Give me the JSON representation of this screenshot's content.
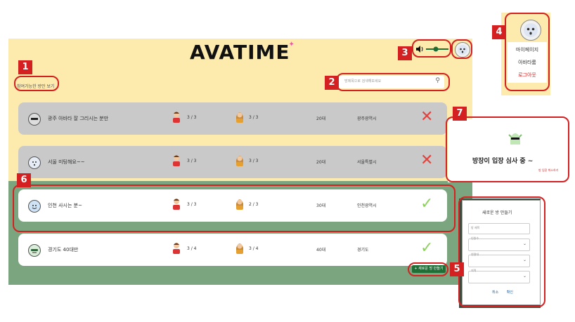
{
  "header": {
    "logo": "AVATIME",
    "filter_link": "참여가능한 방만 보기",
    "search_placeholder": "방제목으로 검색해보세요"
  },
  "rooms": [
    {
      "title": "광주 아바타 잘 그리시는 분만",
      "male": "3 / 3",
      "female": "3 / 3",
      "age": "20대",
      "region": "광주광역시",
      "status": "✕"
    },
    {
      "title": "서울 미팅해요~~",
      "male": "3 / 3",
      "female": "3 / 3",
      "age": "20대",
      "region": "서울특별시",
      "status": "✕"
    },
    {
      "title": "인천 사시는 분~",
      "male": "3 / 3",
      "female": "2 / 3",
      "age": "30대",
      "region": "인천광역시",
      "status": "✓"
    },
    {
      "title": "경기도 40대만",
      "male": "3 / 4",
      "female": "3 / 4",
      "age": "40대",
      "region": "경기도",
      "status": "✓"
    }
  ],
  "create_button": "+ 새로운 방 만들기",
  "dropdown": {
    "items": [
      "마이페이지",
      "아바타룸",
      "로그아웃"
    ]
  },
  "waiting": {
    "text": "방장이 입장 심사 중 ~",
    "exit": "방 입장 취소하기"
  },
  "form": {
    "title": "새로운 방 만들기",
    "fields": [
      "방 제목",
      "인원수",
      "연령대",
      "지역"
    ],
    "cancel": "취소",
    "confirm": "확인"
  },
  "callouts": [
    "1",
    "2",
    "3",
    "4",
    "5",
    "6",
    "7"
  ],
  "colors": {
    "bg_yellow": "#fdebae",
    "bg_green": "#7aa57f",
    "callout_red": "#d42020",
    "full_row": "#c9c9c9",
    "x_red": "#e0433e",
    "check_green": "#8fd15f"
  }
}
